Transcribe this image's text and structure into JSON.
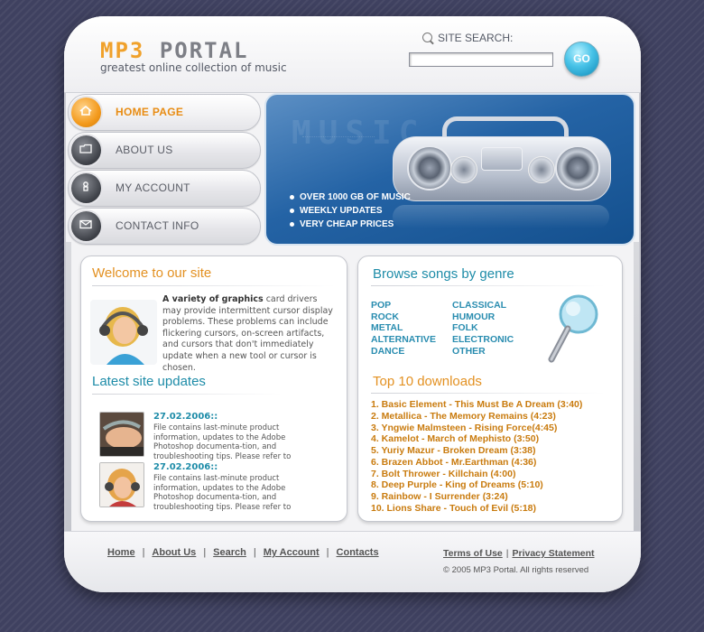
{
  "header": {
    "logo_part1": "MP3",
    "logo_part2": "PORTAL",
    "tagline": "greatest online collection of music",
    "search_label": "SITE SEARCH:",
    "search_value": "",
    "go_label": "GO"
  },
  "nav": [
    {
      "label": "HOME PAGE",
      "icon": "home-icon"
    },
    {
      "label": "ABOUT US",
      "icon": "folder-icon"
    },
    {
      "label": "MY ACCOUNT",
      "icon": "user-icon"
    },
    {
      "label": "CONTACT INFO",
      "icon": "envelope-icon"
    }
  ],
  "banner": {
    "bg_text": "MUSIC",
    "bullets": [
      "OVER 1000 GB OF MUSIC",
      "WEEKLY UPDATES",
      "VERY CHEAP PRICES"
    ]
  },
  "welcome": {
    "title": "Welcome to our site",
    "lead": "A variety of graphics",
    "text": " card drivers may provide intermittent cursor display problems. These  problems can include flickering cursors, on-screen artifacts, and cursors that don't immediately update when a new tool or cursor is chosen."
  },
  "updates": {
    "title": "Latest site updates",
    "items": [
      {
        "date": "27.02.2006::",
        "text": "File contains last-minute product information, updates to the Adobe Photoshop documenta-tion, and troubleshooting tips. Please refer to"
      },
      {
        "date": "27.02.2006::",
        "text": "File contains last-minute product information, updates to the Adobe Photoshop documenta-tion, and troubleshooting tips. Please refer to"
      }
    ]
  },
  "genres": {
    "title": "Browse songs by genre",
    "col1": [
      "POP",
      "ROCK",
      "METAL",
      "ALTERNATIVE",
      "DANCE"
    ],
    "col2": [
      "CLASSICAL",
      "HUMOUR",
      "FOLK",
      "ELECTRONIC",
      "OTHER"
    ]
  },
  "top10": {
    "title": "Top 10 downloads",
    "items": [
      "1. Basic Element - This Must Be A Dream (3:40)",
      "2. Metallica - The Memory Remains (4:23)",
      "3. Yngwie Malmsteen - Rising Force(4:45)",
      "4. Kamelot - March of Mephisto (3:50)",
      "5. Yuriy Mazur - Broken Dream (3:38)",
      "6. Brazen Abbot - Mr.Earthman (4:36)",
      "7. Bolt Thrower - Killchain (4:00)",
      "8. Deep Purple - King of Dreams (5:10)",
      "9. Rainbow - I Surrender (3:24)",
      "10. Lions Share - Touch of Evil (5:18)"
    ]
  },
  "footer": {
    "links": [
      "Home",
      "About Us",
      "Search",
      "My Account",
      "Contacts"
    ],
    "terms": "Terms of Use",
    "privacy": "Privacy Statement",
    "copyright": "© 2005 MP3 Portal. All rights reserved"
  },
  "colors": {
    "accent_orange": "#e88c13",
    "accent_teal": "#1e8ca8",
    "background": "#3f4160",
    "banner_blue": "#2463a5"
  }
}
